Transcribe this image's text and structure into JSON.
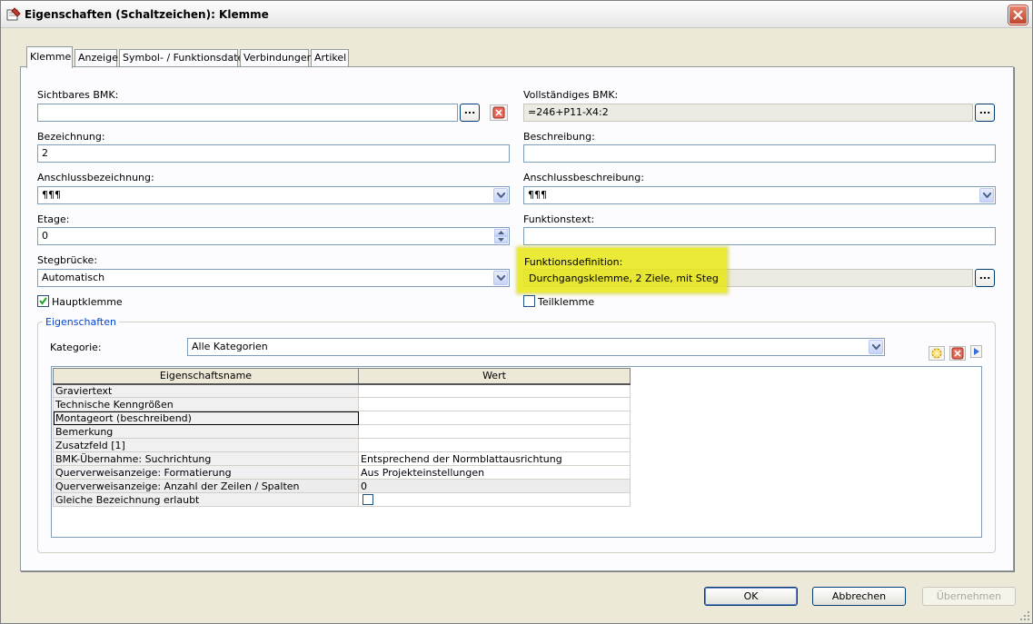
{
  "window": {
    "title": "Eigenschaften (Schaltzeichen): Klemme"
  },
  "tabs": [
    {
      "label": "Klemme",
      "active": true
    },
    {
      "label": "Anzeige"
    },
    {
      "label": "Symbol- / Funktionsdaten"
    },
    {
      "label": "Verbindungen"
    },
    {
      "label": "Artikel"
    }
  ],
  "fields": {
    "sichtbares_bmk": {
      "label": "Sichtbares BMK:",
      "value": "",
      "button": "..."
    },
    "vollstaendiges_bmk": {
      "label": "Vollständiges BMK:",
      "value": "=246+P11-X4:2",
      "button": "..."
    },
    "bezeichnung": {
      "label": "Bezeichnung:",
      "value": "2"
    },
    "beschreibung": {
      "label": "Beschreibung:",
      "value": ""
    },
    "anschlussbezeichnung": {
      "label": "Anschlussbezeichnung:",
      "value": "¶¶¶"
    },
    "anschlussbeschreibung": {
      "label": "Anschlussbeschreibung:",
      "value": "¶¶¶"
    },
    "etage": {
      "label": "Etage:",
      "value": "0"
    },
    "funktionstext": {
      "label": "Funktionstext:",
      "value": ""
    },
    "stegbruecke": {
      "label": "Stegbrücke:",
      "value": "Automatisch"
    },
    "funktionsdefinition": {
      "label": "Funktionsdefinition:",
      "value": "Durchgangsklemme, 2 Ziele, mit Steg",
      "button": "..."
    },
    "hauptklemme": {
      "label": "Hauptklemme",
      "checked": true
    },
    "teilklemme": {
      "label": "Teilklemme",
      "checked": false
    }
  },
  "eigenschaften": {
    "group_title": "Eigenschaften",
    "kategorie_label": "Kategorie:",
    "kategorie_value": "Alle Kategorien",
    "columns": [
      "Eigenschaftsname",
      "Wert"
    ],
    "rows": [
      {
        "name": "Graviertext",
        "value": ""
      },
      {
        "name": "Technische Kenngrößen",
        "value": ""
      },
      {
        "name": "Montageort (beschreibend)",
        "value": ""
      },
      {
        "name": "Bemerkung",
        "value": ""
      },
      {
        "name": "Zusatzfeld [1]",
        "value": ""
      },
      {
        "name": "BMK-Übernahme: Suchrichtung",
        "value": "Entsprechend der Normblattausrichtung"
      },
      {
        "name": "Querverweisanzeige: Formatierung",
        "value": "Aus Projekteinstellungen"
      },
      {
        "name": "Querverweisanzeige: Anzahl der Zeilen / Spalten",
        "value": "0"
      },
      {
        "name": "Gleiche Bezeichnung erlaubt",
        "value": ""
      }
    ]
  },
  "buttons": {
    "ok": "OK",
    "cancel": "Abbrechen",
    "apply": "Übernehmen"
  },
  "colors": {
    "highlight": "#e6e614",
    "group_title": "#0046d5",
    "close": "#c0452c"
  }
}
